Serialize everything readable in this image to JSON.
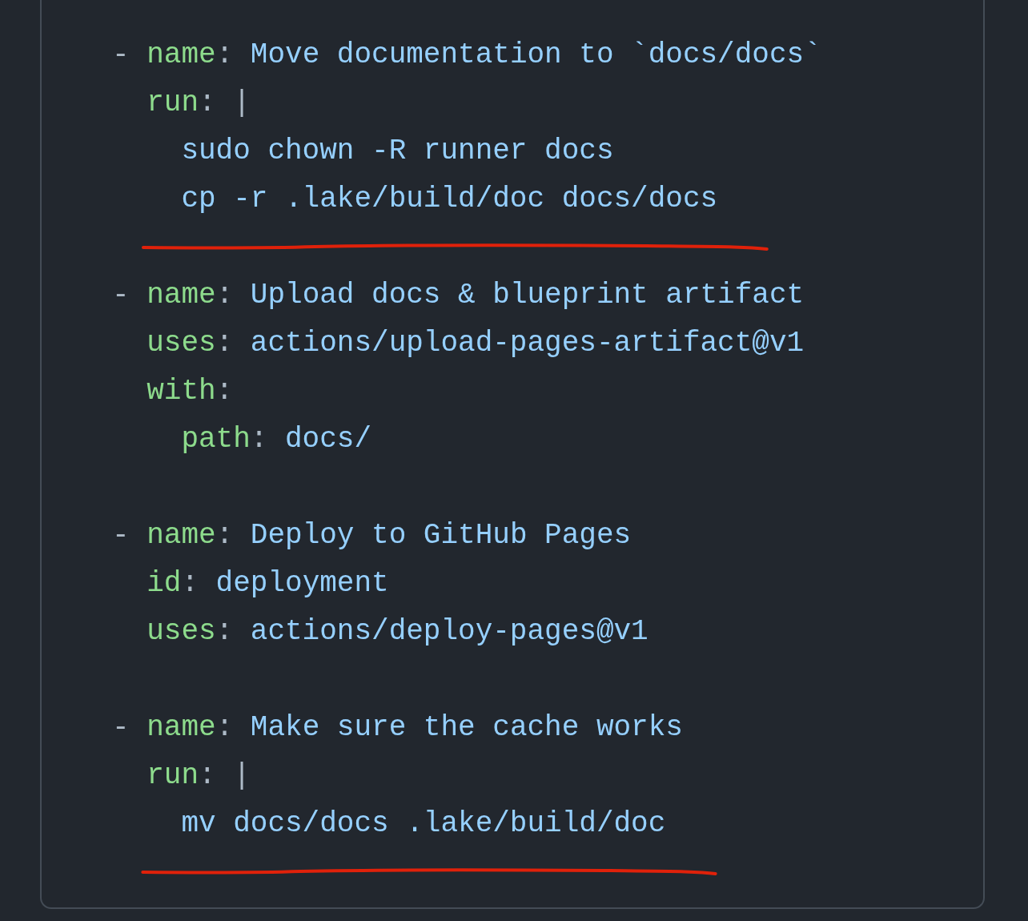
{
  "steps": [
    {
      "dash": "-",
      "underlined": true,
      "fields": [
        {
          "key": "name",
          "sep": ":",
          "value": "Move documentation to `docs/docs`"
        },
        {
          "key": "run",
          "sep": ":",
          "value": "|",
          "lines": [
            "sudo chown -R runner docs",
            "cp -r .lake/build/doc docs/docs"
          ]
        }
      ]
    },
    {
      "dash": "-",
      "underlined": false,
      "fields": [
        {
          "key": "name",
          "sep": ":",
          "value": "Upload docs & blueprint artifact"
        },
        {
          "key": "uses",
          "sep": ":",
          "value": "actions/upload-pages-artifact@v1"
        },
        {
          "key": "with",
          "sep": ":",
          "children": [
            {
              "key": "path",
              "sep": ":",
              "value": "docs/"
            }
          ]
        }
      ]
    },
    {
      "dash": "-",
      "underlined": false,
      "fields": [
        {
          "key": "name",
          "sep": ":",
          "value": "Deploy to GitHub Pages"
        },
        {
          "key": "id",
          "sep": ":",
          "value": "deployment"
        },
        {
          "key": "uses",
          "sep": ":",
          "value": "actions/deploy-pages@v1"
        }
      ]
    },
    {
      "dash": "-",
      "underlined": true,
      "fields": [
        {
          "key": "name",
          "sep": ":",
          "value": "Make sure the cache works"
        },
        {
          "key": "run",
          "sep": ":",
          "value": "|",
          "lines": [
            "mv docs/docs .lake/build/doc"
          ]
        }
      ]
    }
  ]
}
